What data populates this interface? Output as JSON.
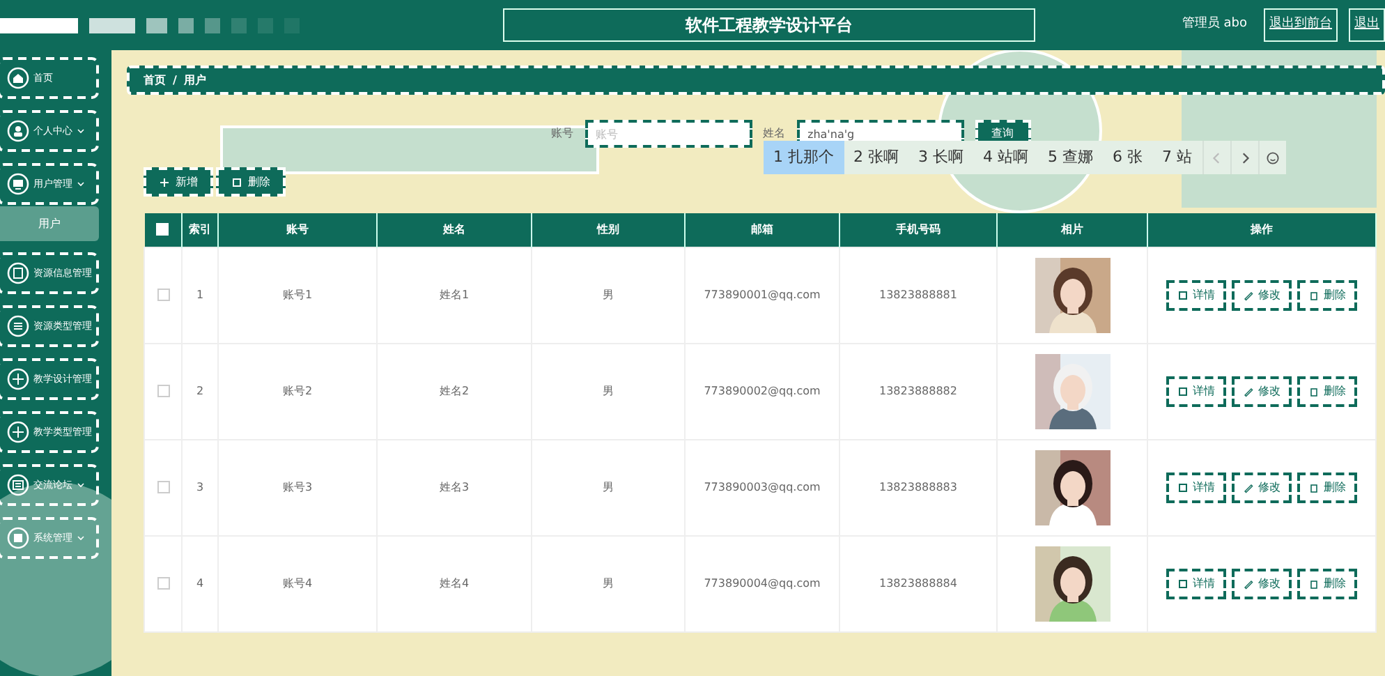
{
  "header": {
    "title": "软件工程教学设计平台",
    "user": "管理员 abo",
    "links": [
      "退出到前台",
      "退出"
    ]
  },
  "sidebar": {
    "items": [
      {
        "label": "首页",
        "selected": false
      },
      {
        "label": "个人中心",
        "expandable": true,
        "selected": false
      },
      {
        "label": "用户管理",
        "expandable": true,
        "selected": false,
        "children": [
          {
            "label": "用户",
            "selected": true
          }
        ]
      },
      {
        "label": "资源信息管理",
        "selected": false
      },
      {
        "label": "资源类型管理",
        "selected": false
      },
      {
        "label": "教学设计管理",
        "selected": false
      },
      {
        "label": "教学类型管理",
        "selected": false
      },
      {
        "label": "交流论坛",
        "expandable": true,
        "selected": false
      },
      {
        "label": "系统管理",
        "expandable": true,
        "selected": false
      }
    ]
  },
  "breadcrumb": {
    "items": [
      "首页",
      "用户"
    ],
    "separator": "/"
  },
  "search": {
    "fields": [
      {
        "label": "账号",
        "placeholder": "账号"
      },
      {
        "label": "姓名",
        "value": "zha'na'g"
      }
    ],
    "button": "查询"
  },
  "actions": [
    "新增",
    "删除"
  ],
  "ime": {
    "candidates": [
      {
        "label": "1 扎那个",
        "selected": true
      },
      {
        "label": "2 张啊",
        "selected": false
      },
      {
        "label": "3 长啊",
        "selected": false
      },
      {
        "label": "4 站啊",
        "selected": false
      },
      {
        "label": "5 查娜",
        "selected": false
      },
      {
        "label": "6 张",
        "selected": false
      },
      {
        "label": "7 站",
        "selected": false
      }
    ]
  },
  "table": {
    "columns": [
      "索引",
      "账号",
      "姓名",
      "性别",
      "邮箱",
      "手机号码",
      "相片",
      "操作"
    ],
    "select_all_checked": false,
    "rows": [
      {
        "checked": false,
        "cells": [
          "1",
          "账号1",
          "姓名1",
          "男",
          "773890001@qq.com",
          "13823888881"
        ],
        "photo": {
          "kind": "picture"
        },
        "actions": [
          "详情",
          "修改",
          "删除"
        ]
      },
      {
        "checked": false,
        "cells": [
          "2",
          "账号2",
          "姓名2",
          "男",
          "773890002@qq.com",
          "13823888882"
        ],
        "photo": {
          "kind": "picture"
        },
        "actions": [
          "详情",
          "修改",
          "删除"
        ]
      },
      {
        "checked": false,
        "cells": [
          "3",
          "账号3",
          "姓名3",
          "男",
          "773890003@qq.com",
          "13823888883"
        ],
        "photo": {
          "kind": "picture"
        },
        "actions": [
          "详情",
          "修改",
          "删除"
        ]
      },
      {
        "checked": false,
        "cells": [
          "4",
          "账号4",
          "姓名4",
          "男",
          "773890004@qq.com",
          "13823888884"
        ],
        "photo": {
          "kind": "picture"
        },
        "actions": [
          "详情",
          "修改",
          "删除"
        ]
      }
    ]
  }
}
